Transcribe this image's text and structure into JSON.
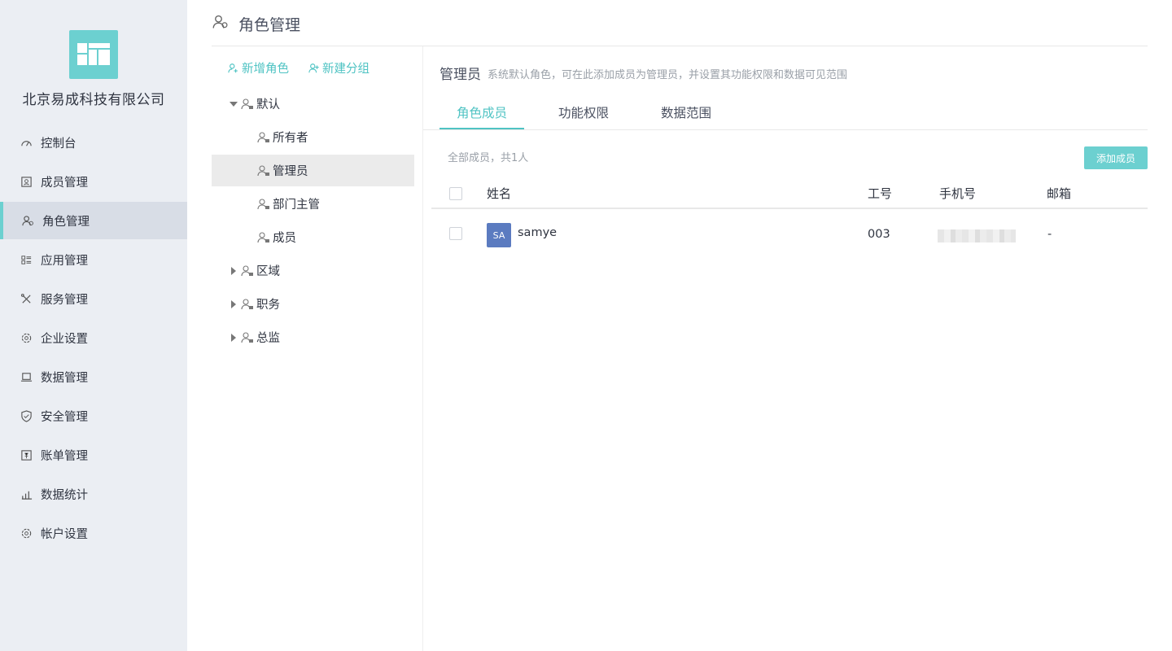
{
  "sidebar": {
    "company": "北京易成科技有限公司",
    "items": [
      {
        "label": "控制台",
        "icon": "speedometer-icon"
      },
      {
        "label": "成员管理",
        "icon": "member-card-icon"
      },
      {
        "label": "角色管理",
        "icon": "users-icon",
        "active": true
      },
      {
        "label": "应用管理",
        "icon": "app-list-icon"
      },
      {
        "label": "服务管理",
        "icon": "tools-icon"
      },
      {
        "label": "企业设置",
        "icon": "gear-icon"
      },
      {
        "label": "数据管理",
        "icon": "laptop-icon"
      },
      {
        "label": "安全管理",
        "icon": "shield-icon"
      },
      {
        "label": "账单管理",
        "icon": "bill-icon"
      },
      {
        "label": "数据统计",
        "icon": "bar-chart-icon"
      },
      {
        "label": "帐户设置",
        "icon": "settings-icon"
      }
    ]
  },
  "header": {
    "title": "角色管理"
  },
  "tree": {
    "actions": {
      "add_role": "新增角色",
      "add_group": "新建分组"
    },
    "groups": [
      {
        "label": "默认",
        "expanded": true,
        "children": [
          "所有者",
          "管理员",
          "部门主管",
          "成员"
        ]
      },
      {
        "label": "区域",
        "expanded": false
      },
      {
        "label": "职务",
        "expanded": false
      },
      {
        "label": "总监",
        "expanded": false
      }
    ],
    "selected": "管理员"
  },
  "content": {
    "role_name": "管理员",
    "role_desc": "系统默认角色，可在此添加成员为管理员，并设置其功能权限和数据可见范围",
    "tabs": [
      "角色成员",
      "功能权限",
      "数据范围"
    ],
    "active_tab": "角色成员",
    "member_count": "全部成员，共1人",
    "add_button": "添加成员",
    "table": {
      "headers": [
        "姓名",
        "工号",
        "手机号",
        "邮箱"
      ],
      "rows": [
        {
          "avatar": "SA",
          "name": "samye",
          "employee_id": "003",
          "phone": "",
          "email": "-"
        }
      ]
    }
  },
  "colors": {
    "accent": "#6cd0d0",
    "accent_text": "#4fc3c3",
    "sidebar_bg": "#ebeef3",
    "avatar": "#5b7bc0"
  }
}
